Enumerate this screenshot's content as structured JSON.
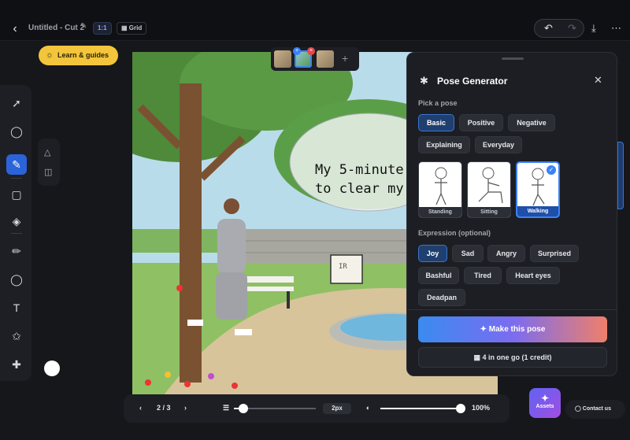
{
  "header": {
    "title": "Untitled - Cut 2",
    "ratio": "1:1",
    "grid_label": "Grid"
  },
  "learn_button": {
    "label": "Learn & guides"
  },
  "canvas": {
    "speech_text_line1": "My 5-minute",
    "speech_text_line2": "to clear my",
    "sign_text": "IR"
  },
  "bottom_bar": {
    "page": "2 / 3",
    "brush_size": "2px",
    "opacity": "100%",
    "brush_slider_fraction": 0.12,
    "opacity_slider_fraction": 1.0
  },
  "pose_panel": {
    "title": "Pose Generator",
    "pick_label": "Pick a pose",
    "categories": [
      {
        "label": "Basic",
        "selected": true
      },
      {
        "label": "Positive",
        "selected": false
      },
      {
        "label": "Negative",
        "selected": false
      },
      {
        "label": "Explaining",
        "selected": false
      },
      {
        "label": "Everyday",
        "selected": false
      }
    ],
    "poses": [
      {
        "label": "Standing",
        "selected": false
      },
      {
        "label": "Sitting",
        "selected": false
      },
      {
        "label": "Walking",
        "selected": true
      }
    ],
    "expression_label": "Expression (optional)",
    "expressions": [
      {
        "label": "Joy",
        "selected": true
      },
      {
        "label": "Sad",
        "selected": false
      },
      {
        "label": "Angry",
        "selected": false
      },
      {
        "label": "Surprised",
        "selected": false
      },
      {
        "label": "Bashful",
        "selected": false
      },
      {
        "label": "Tired",
        "selected": false
      },
      {
        "label": "Heart eyes",
        "selected": false
      },
      {
        "label": "Deadpan",
        "selected": false
      }
    ],
    "make_button": "Make this pose",
    "four_button": "4 in one go (1 credit)"
  },
  "side": {
    "assets_label": "Assets",
    "contact_label": "Contact us"
  }
}
